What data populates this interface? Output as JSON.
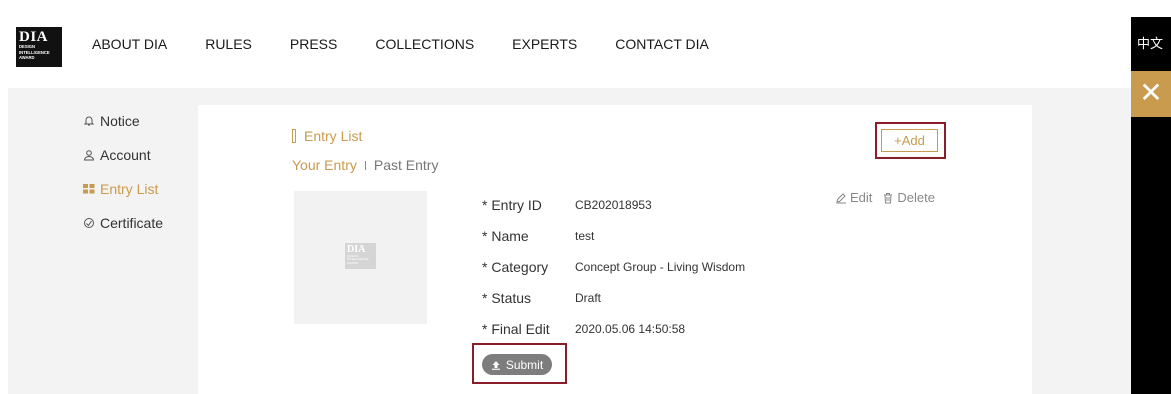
{
  "logo": {
    "mark": "DIA",
    "sub_lines": [
      "DESIGN",
      "INTELLIGENCE",
      "AWARD"
    ]
  },
  "nav": {
    "items": [
      {
        "label": "ABOUT DIA"
      },
      {
        "label": "RULES"
      },
      {
        "label": "PRESS"
      },
      {
        "label": "COLLECTIONS"
      },
      {
        "label": "EXPERTS"
      },
      {
        "label": "CONTACT DIA"
      }
    ],
    "language": "中文",
    "close_icon": "close-icon"
  },
  "sidebar": {
    "items": [
      {
        "label": "Notice",
        "icon": "bell-icon"
      },
      {
        "label": "Account",
        "icon": "user-icon"
      },
      {
        "label": "Entry List",
        "icon": "grid-icon",
        "active": true
      },
      {
        "label": "Certificate",
        "icon": "certificate-icon"
      }
    ]
  },
  "main": {
    "title": "Entry List",
    "tabs": [
      {
        "label": "Your Entry",
        "active": true
      },
      {
        "label": "Past Entry"
      }
    ],
    "add_label": "+Add",
    "entry": {
      "fields": [
        {
          "label": "* Entry ID",
          "value": "CB202018953"
        },
        {
          "label": "* Name",
          "value": "test"
        },
        {
          "label": "* Category",
          "value": "Concept Group - Living Wisdom"
        },
        {
          "label": "* Status",
          "value": "Draft"
        },
        {
          "label": "* Final Edit",
          "value": "2020.05.06 14:50:58"
        }
      ],
      "edit_label": "Edit",
      "delete_label": "Delete",
      "submit_label": "Submit"
    }
  },
  "colors": {
    "accent": "#c89b4e",
    "highlight_frame": "#8b1c2a",
    "submit_bg": "#7d7d7d"
  }
}
